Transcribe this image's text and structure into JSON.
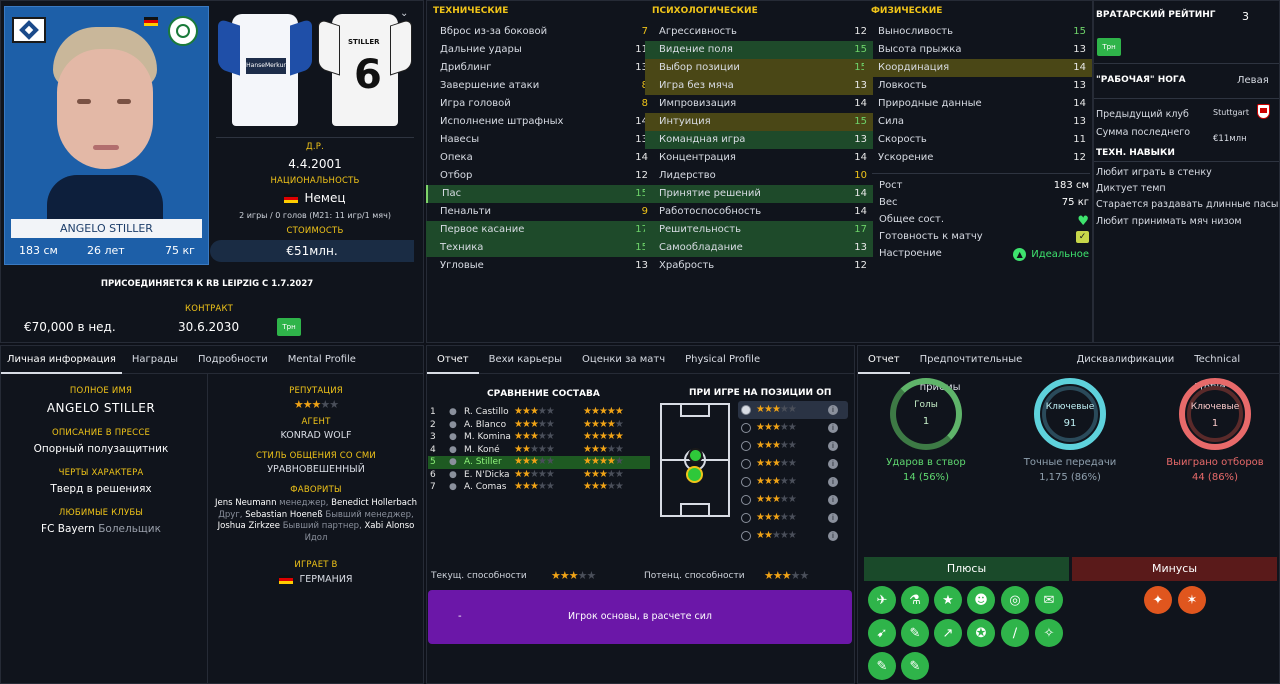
{
  "player": {
    "name": "ANGELO STILLER",
    "height": "183 см",
    "age": "26 лет",
    "weight": "75 кг"
  },
  "info": {
    "dob_label": "Д.Р.",
    "dob": "4.4.2001",
    "nat_label": "НАЦИОНАЛЬНОСТЬ",
    "nat": "Немец",
    "caps": "2 игры / 0 голов (М21: 11 игр/1 мяч)",
    "value_label": "СТОИМОСТЬ",
    "value": "€51млн."
  },
  "transfer": {
    "text": "ПРИСОЕДИНЯЕТСЯ К RB LEIPZIG С 1.7.2027",
    "contract_label": "КОНТРАКТ",
    "wage": "€70,000 в нед.",
    "contract_end": "30.6.2030",
    "badge": "Трн"
  },
  "technical": {
    "title": "ТЕХНИЧЕСКИЕ",
    "rows": [
      {
        "n": "Вброс из-за боковой",
        "v": "7"
      },
      {
        "n": "Дальние удары",
        "v": "11"
      },
      {
        "n": "Дриблинг",
        "v": "13"
      },
      {
        "n": "Завершение атаки",
        "v": "8"
      },
      {
        "n": "Игра головой",
        "v": "8"
      },
      {
        "n": "Исполнение штрафных",
        "v": "14"
      },
      {
        "n": "Навесы",
        "v": "13"
      },
      {
        "n": "Опека",
        "v": "14"
      },
      {
        "n": "Отбор",
        "v": "12"
      },
      {
        "n": "Пас",
        "v": "15"
      },
      {
        "n": "Пенальти",
        "v": "9"
      },
      {
        "n": "Первое касание",
        "v": "17"
      },
      {
        "n": "Техника",
        "v": "15"
      },
      {
        "n": "Угловые",
        "v": "13"
      }
    ]
  },
  "mental": {
    "title": "ПСИХОЛОГИЧЕСКИЕ",
    "rows": [
      {
        "n": "Агрессивность",
        "v": "12"
      },
      {
        "n": "Видение поля",
        "v": "15"
      },
      {
        "n": "Выбор позиции",
        "v": "15"
      },
      {
        "n": "Игра без мяча",
        "v": "13"
      },
      {
        "n": "Импровизация",
        "v": "14"
      },
      {
        "n": "Интуиция",
        "v": "15"
      },
      {
        "n": "Командная игра",
        "v": "13"
      },
      {
        "n": "Концентрация",
        "v": "14"
      },
      {
        "n": "Лидерство",
        "v": "10"
      },
      {
        "n": "Принятие решений",
        "v": "14"
      },
      {
        "n": "Работоспособность",
        "v": "14"
      },
      {
        "n": "Решительность",
        "v": "17"
      },
      {
        "n": "Самообладание",
        "v": "13"
      },
      {
        "n": "Храбрость",
        "v": "12"
      }
    ]
  },
  "physical": {
    "title": "ФИЗИЧЕСКИЕ",
    "rows": [
      {
        "n": "Выносливость",
        "v": "15"
      },
      {
        "n": "Высота прыжка",
        "v": "13"
      },
      {
        "n": "Координация",
        "v": "14"
      },
      {
        "n": "Ловкость",
        "v": "13"
      },
      {
        "n": "Природные данные",
        "v": "14"
      },
      {
        "n": "Сила",
        "v": "13"
      },
      {
        "n": "Скорость",
        "v": "11"
      },
      {
        "n": "Ускорение",
        "v": "12"
      }
    ]
  },
  "body": {
    "height_l": "Рост",
    "height_v": "183 см",
    "weight_l": "Вес",
    "weight_v": "75 кг",
    "cond_l": "Общее сост.",
    "ready_l": "Готовность к матчу",
    "mood_l": "Настроение",
    "mood_v": "Идеальное"
  },
  "right": {
    "gk_l": "ВРАТАРСКИЙ РЕЙТИНГ",
    "gk_v": "3",
    "badge": "Трн",
    "foot_l": "\"РАБОЧАЯ\" НОГА",
    "foot_v": "Левая",
    "prev_l": "Предыдущий клуб",
    "prev_v": "Stuttgart",
    "fee_l": "Сумма последнего",
    "fee_v": "€11млн",
    "skills_t": "ТЕХН. НАВЫКИ",
    "skills": [
      "Любит играть в стенку",
      "Диктует темп",
      "Старается раздавать длинные пасы",
      "Любит принимать мяч низом"
    ]
  },
  "personal": {
    "tabs": [
      "Личная информация",
      "Награды",
      "Подробности",
      "Mental Profile"
    ],
    "full_l": "ПОЛНОЕ ИМЯ",
    "full_v": "ANGELO STILLER",
    "press_l": "ОПИСАНИЕ В ПРЕССЕ",
    "press_v": "Опорный полузащитник",
    "traits_l": "ЧЕРТЫ ХАРАКТЕРА",
    "traits_v": "Тверд в решениях",
    "clubs_l": "ЛЮБИМЫЕ КЛУБЫ",
    "clubs_v": "FC Bayern",
    "clubs_sub": "Болельщик",
    "rep_l": "РЕПУТАЦИЯ",
    "agent_l": "АГЕНТ",
    "agent_v": "KONRAD WOLF",
    "media_l": "СТИЛЬ ОБЩЕНИЯ СО СМИ",
    "media_v": "УРАВНОВЕШЕННЫЙ",
    "fav_l": "ФАВОРИТЫ",
    "fav1a": "Jens Neumann",
    "fav1b": "менеджер,",
    "fav1c": "Benedict Hollerbach",
    "fav2a": "Друг,",
    "fav2b": "Sebastian Hoeneß",
    "fav2c": "Бывший менеджер,",
    "fav3a": "Joshua Zirkzee",
    "fav3b": "Бывший партнер,",
    "fav3c": "Xabi Alonso",
    "fav4": "Идол",
    "plays_l": "ИГРАЕТ В",
    "plays_v": "ГЕРМАНИЯ"
  },
  "report": {
    "tabs": [
      "Отчет",
      "Вехи карьеры",
      "Оценки за матч",
      "Physical Profile"
    ],
    "squad_t": "СРАВНЕНИЕ СОСТАВА",
    "pos_t": "ПРИ ИГРЕ НА ПОЗИЦИИ ОП",
    "players": [
      {
        "n": "1",
        "name": "R. Castillo"
      },
      {
        "n": "2",
        "name": "A. Blanco"
      },
      {
        "n": "3",
        "name": "M. Komina"
      },
      {
        "n": "4",
        "name": "M. Koné"
      },
      {
        "n": "5",
        "name": "A. Stiller"
      },
      {
        "n": "6",
        "name": "E. N'Dicka"
      },
      {
        "n": "7",
        "name": "A. Comas"
      }
    ],
    "cur_l": "Текущ. способности",
    "pot_l": "Потенц. способности",
    "role": "Игрок основы, в расчете сил",
    "dash": "-"
  },
  "stats": {
    "tabs": [
      "Отчет",
      "Предпочтительные приемы",
      "Дисквалификации",
      "Technical Profile"
    ],
    "g1": {
      "top": "Голы",
      "val": "1",
      "l": "Ударов в створ",
      "v": "14 (56%)"
    },
    "g2": {
      "top": "Ключевые",
      "val": "91",
      "l": "Точные передачи",
      "v": "1,175 (86%)"
    },
    "g3": {
      "top": "Ключевые",
      "val": "1",
      "l": "Выиграно отборов",
      "v": "44 (86%)"
    },
    "pros": "Плюсы",
    "cons": "Минусы"
  }
}
